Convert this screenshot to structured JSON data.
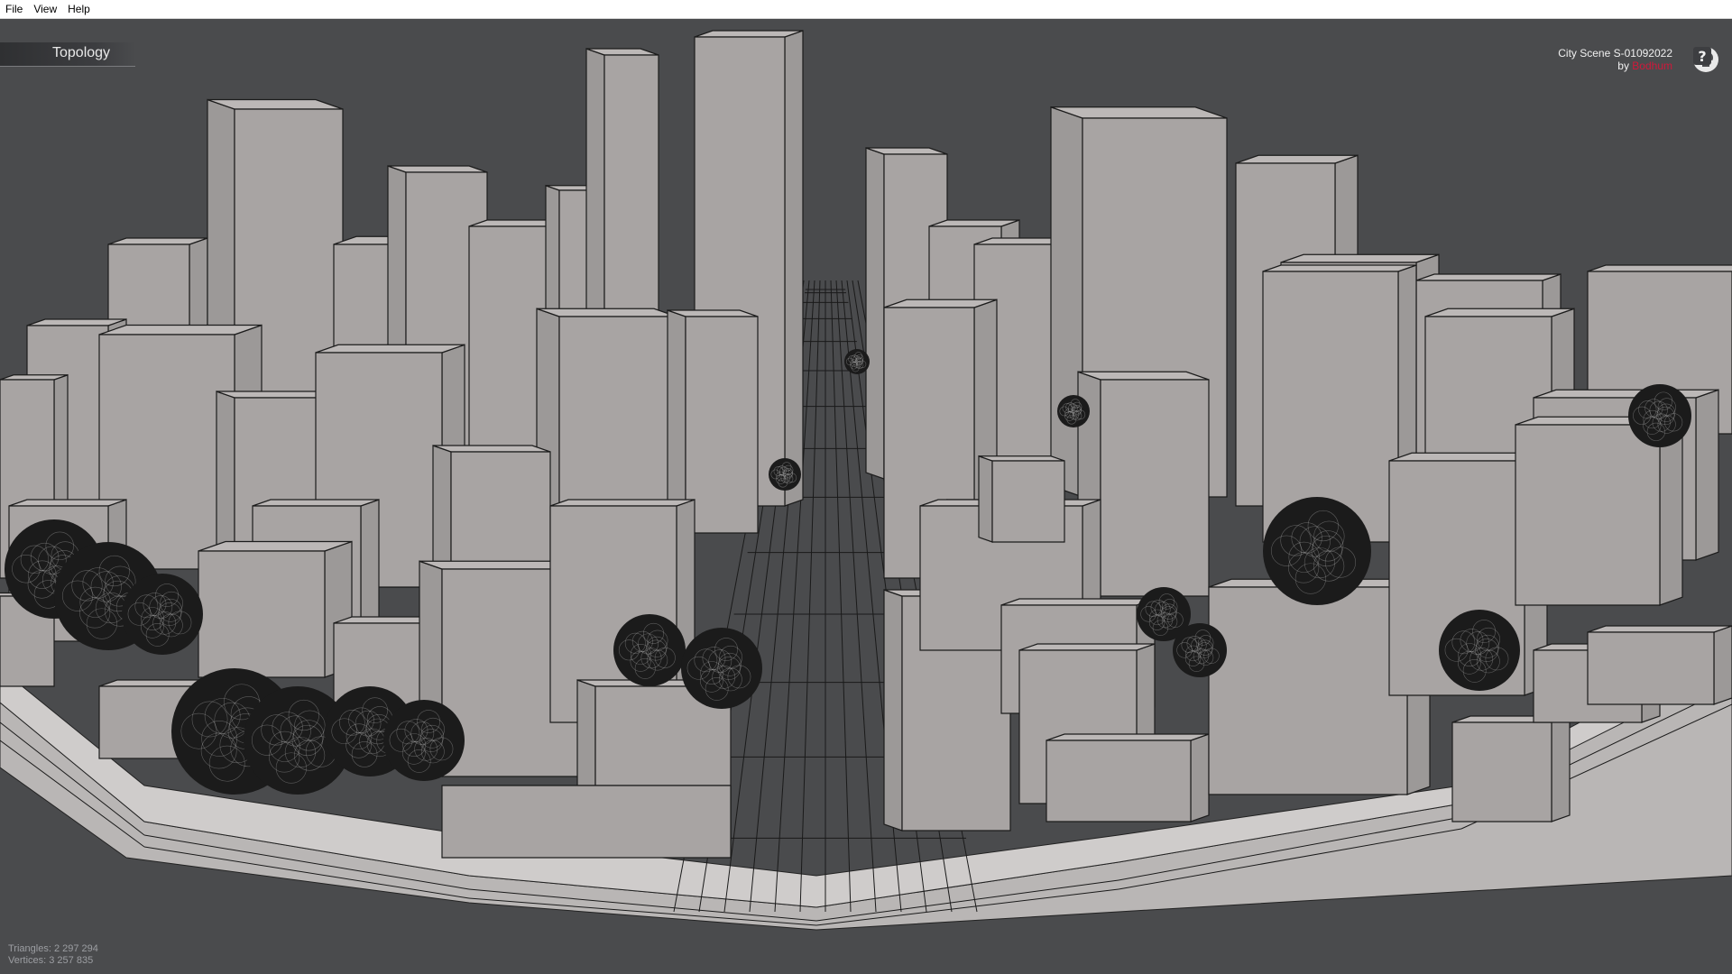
{
  "menu": {
    "items": [
      {
        "label": "File"
      },
      {
        "label": "View"
      },
      {
        "label": "Help"
      }
    ]
  },
  "viewer": {
    "mode_label": "Topology",
    "scene_title": "City Scene S-01092022",
    "author_prefix": "by",
    "author_name": "Bodhum",
    "author_color": "#d0183a",
    "background_color": "#4a4b4d",
    "model_surface_color": "#a8a4a3"
  },
  "tools": [
    {
      "icon": "skull-icon",
      "tooltip": ""
    },
    {
      "icon": "square-icon",
      "tooltip": ""
    },
    {
      "icon": "slash-lines-icon",
      "tooltip": ""
    },
    {
      "icon": "help-icon",
      "glyph": "?"
    }
  ],
  "stats": {
    "triangles_label": "Triangles:",
    "triangles_value": "2 297 294",
    "vertices_label": "Vertices:",
    "vertices_value": "3 257 835"
  }
}
